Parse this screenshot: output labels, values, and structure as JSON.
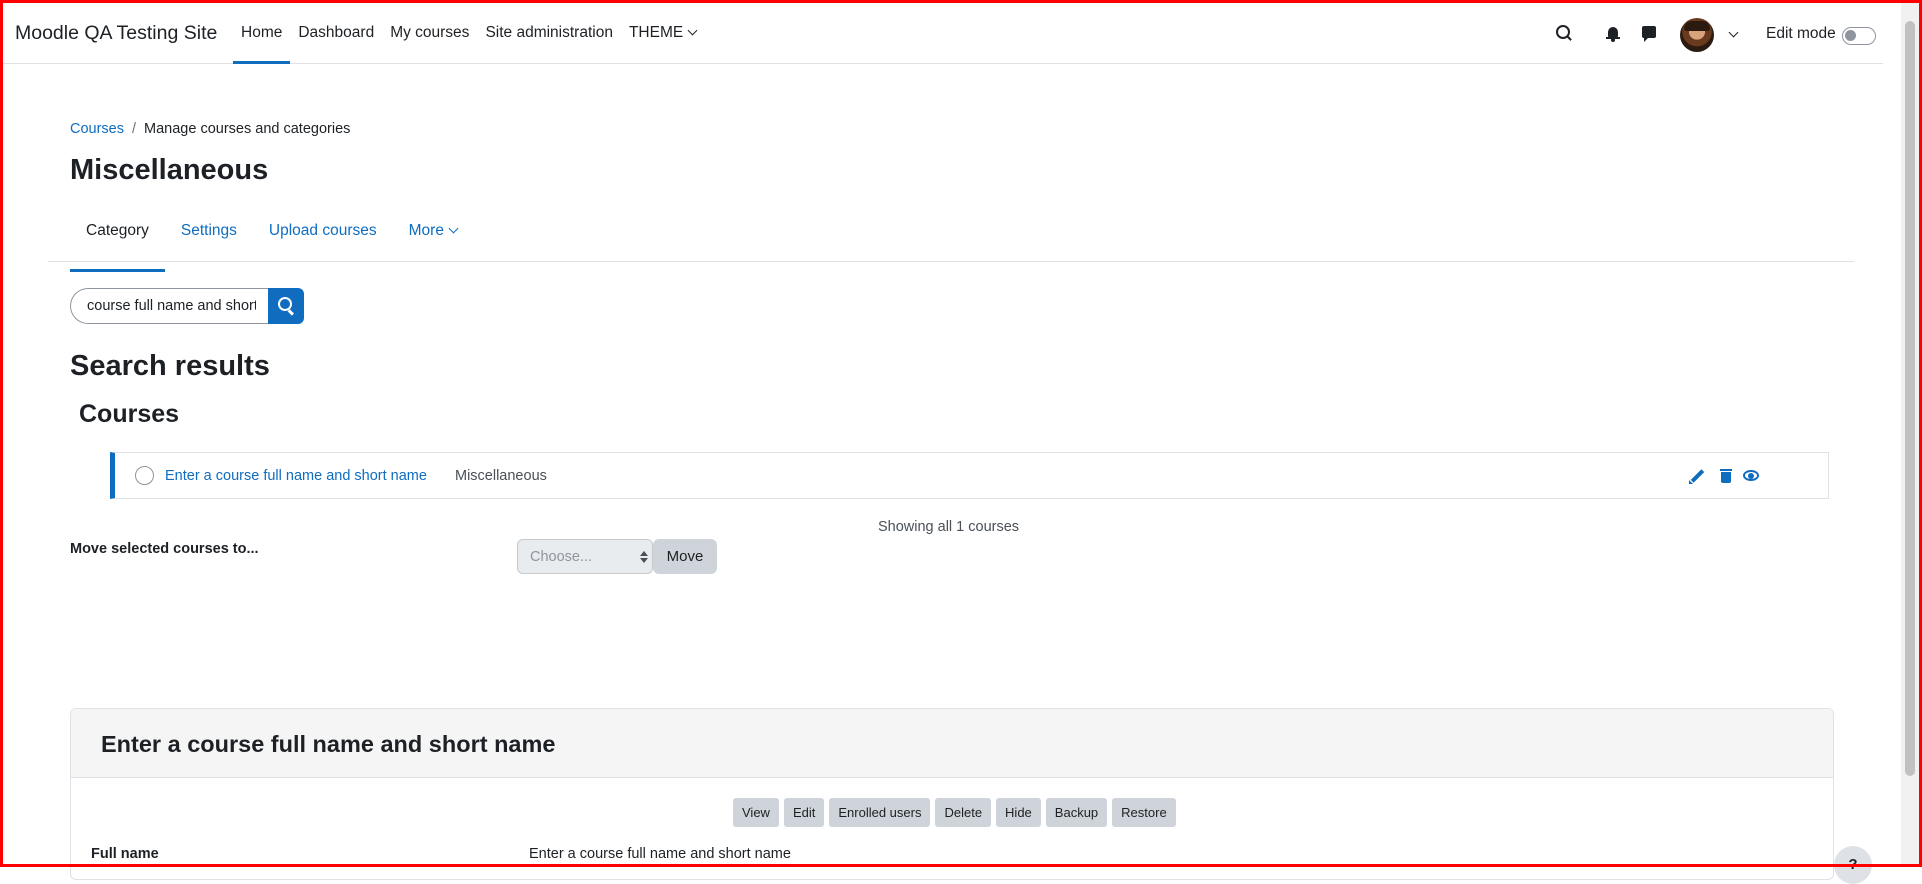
{
  "navbar": {
    "brand": "Moodle QA Testing Site",
    "items": [
      {
        "label": "Home"
      },
      {
        "label": "Dashboard"
      },
      {
        "label": "My courses"
      },
      {
        "label": "Site administration"
      },
      {
        "label": "THEME"
      }
    ],
    "edit_mode_label": "Edit mode"
  },
  "breadcrumb": {
    "items": [
      "Courses",
      "Manage courses and categories"
    ],
    "separator": "/"
  },
  "page_title": "Miscellaneous",
  "secondary_nav": {
    "tabs": [
      {
        "label": "Category"
      },
      {
        "label": "Settings"
      },
      {
        "label": "Upload courses"
      },
      {
        "label": "More"
      }
    ]
  },
  "search": {
    "value": "course full name and short name"
  },
  "results": {
    "heading": "Search results",
    "courses_heading": "Courses",
    "course_rows": [
      {
        "name": "Enter a course full name and short name",
        "category": "Miscellaneous"
      }
    ],
    "showing_text": "Showing all 1 courses"
  },
  "move": {
    "label": "Move selected courses to...",
    "select_placeholder": "Choose...",
    "button": "Move"
  },
  "detail": {
    "title": "Enter a course full name and short name",
    "actions": [
      "View",
      "Edit",
      "Enrolled users",
      "Delete",
      "Hide",
      "Backup",
      "Restore"
    ],
    "full_name_label": "Full name",
    "full_name_value": "Enter a course full name and short name"
  },
  "help_button": "?",
  "colors": {
    "primary": "#0f6cbf",
    "text": "#1d2125",
    "muted": "#495057",
    "border": "#dee2e6",
    "button_secondary": "#ced4da",
    "frame": "#ff0000"
  },
  "icons": [
    "search-icon",
    "bell-icon",
    "chat-icon",
    "avatar",
    "chevron-down-icon",
    "edit-pencil-icon",
    "trash-icon",
    "eye-icon"
  ]
}
